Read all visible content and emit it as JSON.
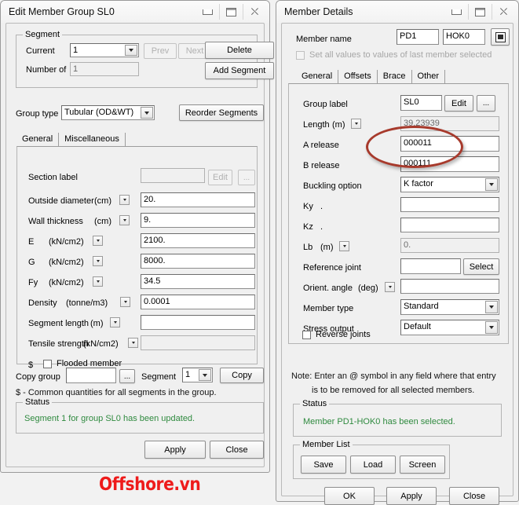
{
  "page": {
    "background": "#f2f2f2",
    "watermark": "Offshore.vn",
    "watermark_color": "#ee1b1b",
    "annotation_color": "#a73a2c",
    "status_color": "#2f8a3f"
  },
  "left_window": {
    "title": "Edit Member Group SL0",
    "controls": {
      "minimize": "minimize-icon",
      "maximize": "maximize-icon",
      "close": "close-icon"
    },
    "segment_group": {
      "legend": "Segment",
      "current_label": "Current",
      "current_value": "1",
      "number_of_label": "Number of",
      "number_of_value": "1",
      "prev_label": "Prev",
      "next_label": "Next",
      "delete_label": "Delete",
      "add_segment_label": "Add Segment"
    },
    "group_type_label": "Group type",
    "group_type_value": "Tubular (OD&WT)",
    "reorder_label": "Reorder Segments",
    "tabs": [
      {
        "label": "General",
        "selected": true
      },
      {
        "label": "Miscellaneous",
        "selected": false
      }
    ],
    "fields": [
      {
        "label": "Section label",
        "unit": "",
        "value": "",
        "disabled": true,
        "has_unit_drop": false
      },
      {
        "label": "Outside diameter",
        "unit": "(cm)",
        "value": "20.",
        "disabled": false,
        "has_unit_drop": true
      },
      {
        "label": "Wall thickness",
        "unit": "(cm)",
        "value": "9.",
        "disabled": false,
        "has_unit_drop": true
      },
      {
        "label": "E",
        "unit": "(kN/cm2)",
        "value": "2100.",
        "disabled": false,
        "has_unit_drop": true
      },
      {
        "label": "G",
        "unit": "(kN/cm2)",
        "value": "8000.",
        "disabled": false,
        "has_unit_drop": true
      },
      {
        "label": "Fy",
        "unit": "(kN/cm2)",
        "value": "34.5",
        "disabled": false,
        "has_unit_drop": true
      },
      {
        "label": "Density",
        "unit": "(tonne/m3)",
        "value": "0.0001",
        "disabled": false,
        "has_unit_drop": true
      },
      {
        "label": "Segment length",
        "unit": "(m)",
        "value": "",
        "disabled": false,
        "has_unit_drop": true
      },
      {
        "label": "Tensile strength",
        "unit": "(kN/cm2)",
        "value": "",
        "disabled": true,
        "has_unit_drop": true
      }
    ],
    "section_edit_label": "Edit",
    "section_ellipsis_label": "...",
    "flooded_prefix": "$",
    "flooded_label": "Flooded member",
    "copy_group_label": "Copy group",
    "copy_group_value": "",
    "copy_ellipsis_label": "...",
    "copy_segment_label": "Segment",
    "copy_segment_value": "1",
    "copy_button_label": "Copy",
    "common_note": "$ - Common quantities for all segments in the group.",
    "status_legend": "Status",
    "status_message": "Segment 1 for group SL0 has been updated.",
    "apply_label": "Apply",
    "close_label": "Close"
  },
  "right_window": {
    "title": "Member Details",
    "controls": {
      "minimize": "minimize-icon",
      "maximize": "maximize-icon",
      "close": "close-icon"
    },
    "member_name_label": "Member name",
    "member_name_a": "PD1",
    "member_name_b": "HOK0",
    "list_button": "list-icon",
    "set_all_label": "Set all values to values of last member selected",
    "tabs": [
      {
        "label": "General",
        "selected": true
      },
      {
        "label": "Offsets",
        "selected": false
      },
      {
        "label": "Brace",
        "selected": false
      },
      {
        "label": "Other",
        "selected": false
      }
    ],
    "group_label_label": "Group label",
    "group_label_value": "SL0",
    "group_edit_label": "Edit",
    "group_ellipsis_label": "...",
    "fields": [
      {
        "label": "Length",
        "unit": "(m)",
        "value": "39.23939",
        "type": "text",
        "disabled": false,
        "has_unit_drop": true
      },
      {
        "label": "A release",
        "unit": "",
        "value": "000011",
        "type": "text",
        "disabled": false,
        "has_unit_drop": false
      },
      {
        "label": "B release",
        "unit": "",
        "value": "000111",
        "type": "text",
        "disabled": false,
        "has_unit_drop": false
      },
      {
        "label": "Buckling option",
        "unit": "",
        "value": "K factor",
        "type": "combo",
        "disabled": false,
        "has_unit_drop": false
      },
      {
        "label": "Ky",
        "unit": ".",
        "value": "",
        "type": "text",
        "disabled": false,
        "has_unit_drop": false
      },
      {
        "label": "Kz",
        "unit": ".",
        "value": "",
        "type": "text",
        "disabled": false,
        "has_unit_drop": false
      },
      {
        "label": "Lb",
        "unit": "(m)",
        "value": "0.",
        "type": "text",
        "disabled": true,
        "has_unit_drop": true
      },
      {
        "label": "Reference joint",
        "unit": "",
        "value": "",
        "type": "text",
        "disabled": false,
        "has_unit_drop": false
      },
      {
        "label": "Orient. angle",
        "unit": "(deg)",
        "value": "",
        "type": "text",
        "disabled": false,
        "has_unit_drop": true
      },
      {
        "label": "Member type",
        "unit": "",
        "value": "Standard",
        "type": "combo",
        "disabled": false,
        "has_unit_drop": false
      },
      {
        "label": "Stress output",
        "unit": "",
        "value": "Default",
        "type": "combo",
        "disabled": false,
        "has_unit_drop": false
      }
    ],
    "select_label": "Select",
    "reverse_joints_label": "Reverse joints",
    "note_line1": "Note: Enter an @ symbol in any field where that entry",
    "note_line2": "is to be removed for all selected members.",
    "status_legend": "Status",
    "status_message": "Member PD1-HOK0 has been selected.",
    "member_list_legend": "Member List",
    "save_label": "Save",
    "load_label": "Load",
    "screen_label": "Screen",
    "ok_label": "OK",
    "apply_label": "Apply",
    "close_label": "Close"
  }
}
